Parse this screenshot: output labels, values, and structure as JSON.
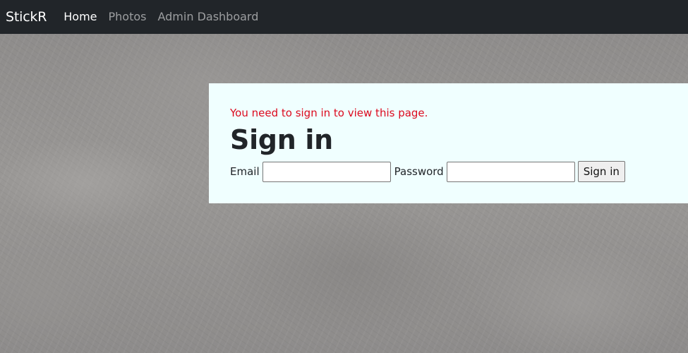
{
  "navbar": {
    "brand": "StickR",
    "links": [
      {
        "label": "Home",
        "active": true
      },
      {
        "label": "Photos",
        "active": false
      },
      {
        "label": "Admin Dashboard",
        "active": false
      }
    ]
  },
  "signin": {
    "alert": "You need to sign in to view this page.",
    "title": "Sign in",
    "email_label": "Email",
    "email_value": "",
    "password_label": "Password",
    "password_value": "",
    "submit_label": "Sign in"
  },
  "colors": {
    "navbar_bg": "#212529",
    "panel_bg": "#f0ffff",
    "alert_text": "#dc0a1e"
  }
}
